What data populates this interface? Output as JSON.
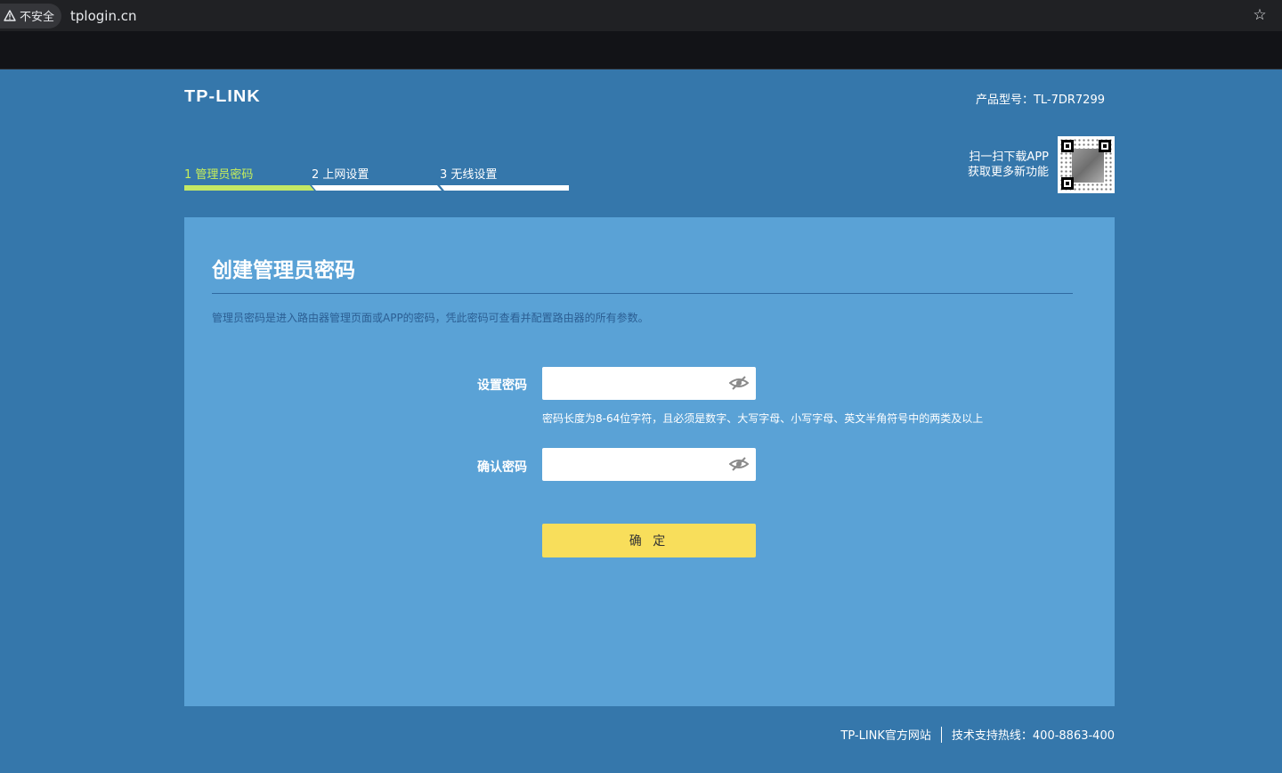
{
  "browser": {
    "security_label": "不安全",
    "url": "tplogin.cn"
  },
  "header": {
    "logo": "TP-LINK",
    "model_label": "产品型号：",
    "model_value": "TL-7DR7299"
  },
  "steps": [
    {
      "label": "1 管理员密码",
      "active": true
    },
    {
      "label": "2 上网设置",
      "active": false
    },
    {
      "label": "3 无线设置",
      "active": false
    }
  ],
  "app_promo": {
    "line1": "扫一扫下载APP",
    "line2": "获取更多新功能"
  },
  "card": {
    "title": "创建管理员密码",
    "description": "管理员密码是进入路由器管理页面或APP的密码，凭此密码可查看并配置路由器的所有参数。",
    "fields": [
      {
        "label": "设置密码",
        "value": "",
        "placeholder": ""
      },
      {
        "label": "确认密码",
        "value": "",
        "placeholder": ""
      }
    ],
    "hint": "密码长度为8-64位字符，且必须是数字、大写字母、小写字母、英文半角符号中的两类及以上",
    "confirm_label": "确 定"
  },
  "footer": {
    "site": "TP-LINK官方网站",
    "hotline": "技术支持热线：400-8863-400"
  },
  "colors": {
    "page_bg": "#3577ab",
    "card_bg": "#5aa2d6",
    "active_step": "#c3e865",
    "button": "#f8de5b"
  }
}
